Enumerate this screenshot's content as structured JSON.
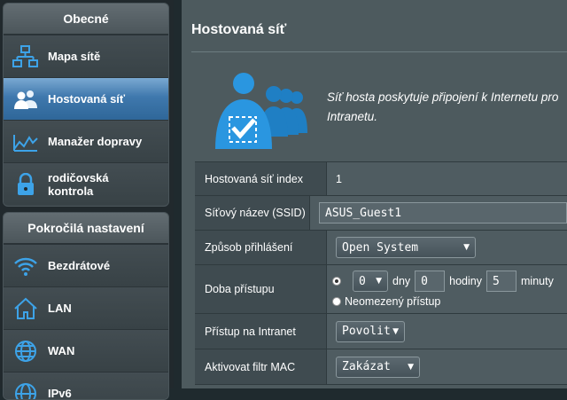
{
  "sidebar": {
    "general_header": "Obecné",
    "general_items": [
      {
        "label": "Mapa sítě",
        "icon": "network-map-icon"
      },
      {
        "label": "Hostovaná síť",
        "icon": "guest-network-icon"
      },
      {
        "label": "Manažer dopravy",
        "icon": "traffic-manager-icon"
      },
      {
        "label1": "rodičovská",
        "label2": "kontrola",
        "icon": "lock-icon"
      }
    ],
    "advanced_header": "Pokročilá nastavení",
    "advanced_items": [
      {
        "label": "Bezdrátové",
        "icon": "wifi-icon"
      },
      {
        "label": "LAN",
        "icon": "home-icon"
      },
      {
        "label": "WAN",
        "icon": "globe-icon"
      },
      {
        "label": "IPv6",
        "icon": "globe-icon"
      }
    ]
  },
  "main": {
    "title": "Hostovaná síť",
    "desc_line1": "Síť hosta poskytuje připojení k Internetu pro",
    "desc_line2": "Intranetu.",
    "form": {
      "index_label": "Hostovaná síť index",
      "index_value": "1",
      "ssid_label": "Síťový název (SSID)",
      "ssid_value": "ASUS_Guest1",
      "auth_label": "Způsob přihlášení",
      "auth_value": "Open System",
      "access_label": "Doba přístupu",
      "days_value": "0",
      "days_unit": "dny",
      "hours_value": "0",
      "hours_unit": "hodiny",
      "minutes_value": "5",
      "minutes_unit": "minuty",
      "unlimited_label": "Neomezený přístup",
      "intranet_label": "Přístup na Intranet",
      "intranet_value": "Povolit",
      "mac_label": "Aktivovat filtr MAC",
      "mac_value": "Zakázat"
    }
  },
  "colors": {
    "accent": "#2f6799",
    "icon_blue": "#2a8fd6"
  }
}
